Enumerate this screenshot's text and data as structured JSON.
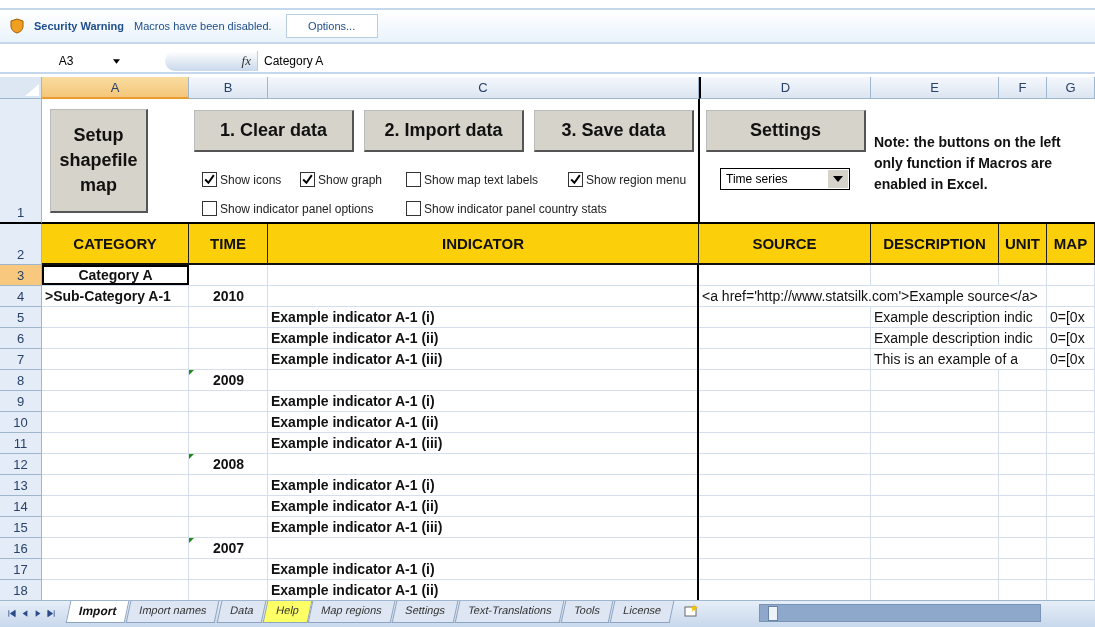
{
  "security_bar": {
    "title": "Security Warning",
    "message": "Macros have been disabled.",
    "button": "Options..."
  },
  "formula_bar": {
    "name_box": "A3",
    "function_button": "fx",
    "value": "Category A"
  },
  "columns": [
    {
      "label": "A",
      "selected": true
    },
    {
      "label": "B",
      "selected": false
    },
    {
      "label": "C",
      "selected": false
    },
    {
      "label": "D",
      "selected": false
    },
    {
      "label": "E",
      "selected": false
    },
    {
      "label": "F",
      "selected": false
    },
    {
      "label": "G",
      "selected": false
    }
  ],
  "controls": {
    "row_number": "1",
    "setup_button": "Setup shapefile map",
    "buttons": [
      "1. Clear data",
      "2. Import data",
      "3. Save data"
    ],
    "settings_button": "Settings",
    "checkboxes": [
      {
        "label": "Show icons",
        "checked": true
      },
      {
        "label": "Show graph",
        "checked": true
      },
      {
        "label": "Show map text labels",
        "checked": false
      },
      {
        "label": "Show region menu",
        "checked": true
      },
      {
        "label": "Show indicator panel options",
        "checked": false
      },
      {
        "label": "Show indicator panel country stats",
        "checked": false
      }
    ],
    "dropdown": {
      "value": "Time series"
    },
    "note": "Note: the buttons on the left only function if Macros are enabled in Excel."
  },
  "header_row": {
    "number": "2",
    "cells": [
      "CATEGORY",
      "TIME",
      "INDICATOR",
      "SOURCE",
      "DESCRIPTION",
      "UNIT",
      "MAP"
    ]
  },
  "rows": [
    {
      "number": "3",
      "kind": "category",
      "selected": true,
      "category": "Category A"
    },
    {
      "number": "4",
      "kind": "subcategory",
      "selected": false,
      "category": ">Sub-Category A-1",
      "time": "2010",
      "source": "<a href='http://www.statsilk.com'>Example source</a>"
    },
    {
      "number": "5",
      "kind": "indicator",
      "selected": false,
      "indicator": "Example indicator A-1 (i)",
      "description": "Example description indic",
      "map": "0=[0x"
    },
    {
      "number": "6",
      "kind": "indicator",
      "selected": false,
      "indicator": "Example indicator A-1 (ii)",
      "description": "Example description indic",
      "map": "0=[0x"
    },
    {
      "number": "7",
      "kind": "indicator",
      "selected": false,
      "indicator": "Example indicator A-1 (iii)",
      "description": "This is an example of a",
      "map": "0=[0x"
    },
    {
      "number": "8",
      "kind": "year",
      "selected": false,
      "time": "2009",
      "marker": true
    },
    {
      "number": "9",
      "kind": "indicator",
      "selected": false,
      "indicator": "Example indicator A-1 (i)"
    },
    {
      "number": "10",
      "kind": "indicator",
      "selected": false,
      "indicator": "Example indicator A-1 (ii)"
    },
    {
      "number": "11",
      "kind": "indicator",
      "selected": false,
      "indicator": "Example indicator A-1 (iii)"
    },
    {
      "number": "12",
      "kind": "year",
      "selected": false,
      "time": "2008",
      "marker": true
    },
    {
      "number": "13",
      "kind": "indicator",
      "selected": false,
      "indicator": "Example indicator A-1 (i)"
    },
    {
      "number": "14",
      "kind": "indicator",
      "selected": false,
      "indicator": "Example indicator A-1 (ii)"
    },
    {
      "number": "15",
      "kind": "indicator",
      "selected": false,
      "indicator": "Example indicator A-1 (iii)"
    },
    {
      "number": "16",
      "kind": "year",
      "selected": false,
      "time": "2007",
      "marker": true
    },
    {
      "number": "17",
      "kind": "indicator",
      "selected": false,
      "indicator": "Example indicator A-1 (i)"
    },
    {
      "number": "18",
      "kind": "indicator",
      "selected": false,
      "indicator": "Example indicator A-1 (ii)"
    }
  ],
  "sheet_tabs": [
    {
      "label": "Import",
      "selected": true
    },
    {
      "label": "Import names",
      "selected": false
    },
    {
      "label": "Data",
      "selected": false
    },
    {
      "label": "Help",
      "selected": false,
      "color": "#ffff66"
    },
    {
      "label": "Map regions",
      "selected": false
    },
    {
      "label": "Settings",
      "selected": false
    },
    {
      "label": "Text-Translations",
      "selected": false
    },
    {
      "label": "Tools",
      "selected": false
    },
    {
      "label": "License",
      "selected": false
    }
  ]
}
